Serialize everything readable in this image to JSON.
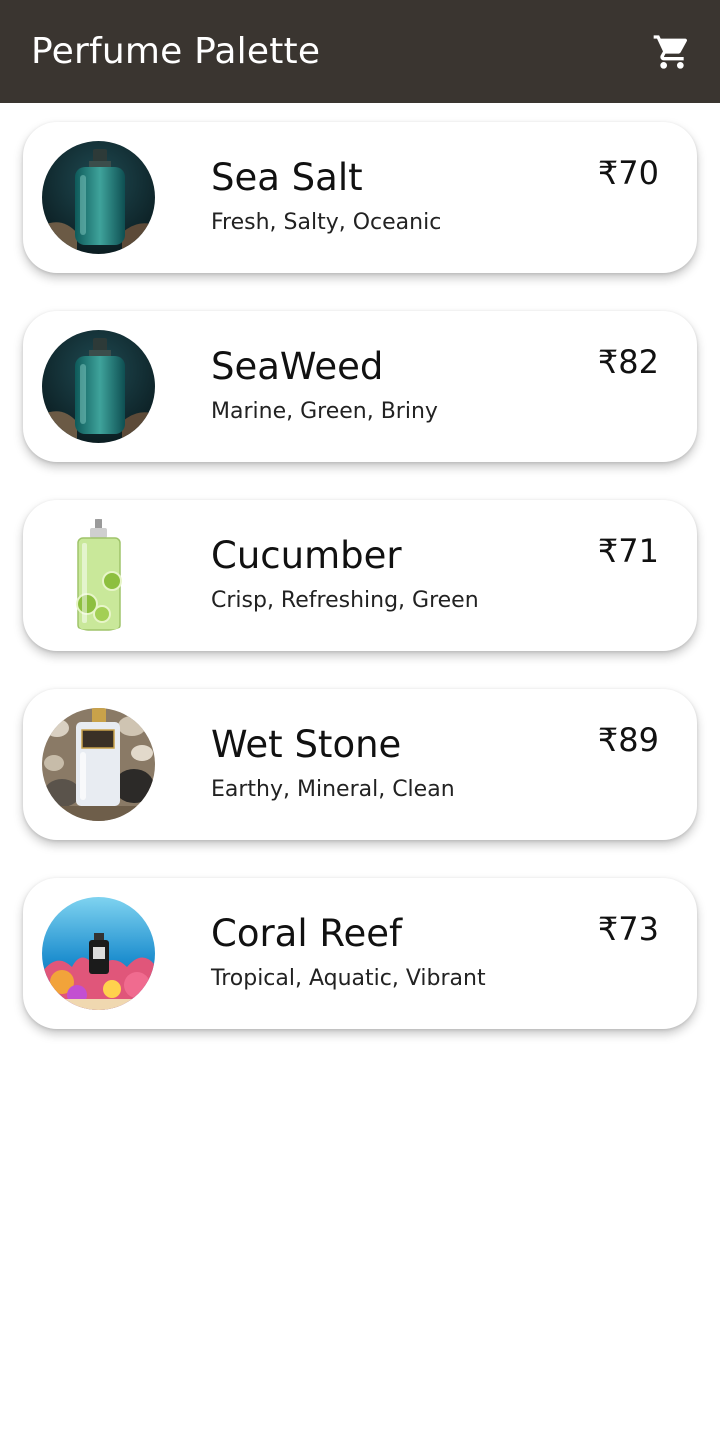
{
  "app_bar": {
    "title": "Perfume Palette",
    "background": "#3a3530",
    "cart_icon": "shopping-cart-icon"
  },
  "products": [
    {
      "name": "Sea Salt",
      "notes": "Fresh, Salty, Oceanic",
      "price": "₹70",
      "image": "teal-bottle-dark"
    },
    {
      "name": "SeaWeed",
      "notes": "Marine, Green, Briny",
      "price": "₹82",
      "image": "teal-bottle-dark"
    },
    {
      "name": "Cucumber",
      "notes": "Crisp, Refreshing, Green",
      "price": "₹71",
      "image": "green-cucumber-bottle"
    },
    {
      "name": "Wet Stone",
      "notes": "Earthy, Mineral, Clean",
      "price": "₹89",
      "image": "white-bottle-stones"
    },
    {
      "name": "Coral Reef",
      "notes": "Tropical, Aquatic, Vibrant",
      "price": "₹73",
      "image": "coral-reef-underwater"
    }
  ]
}
